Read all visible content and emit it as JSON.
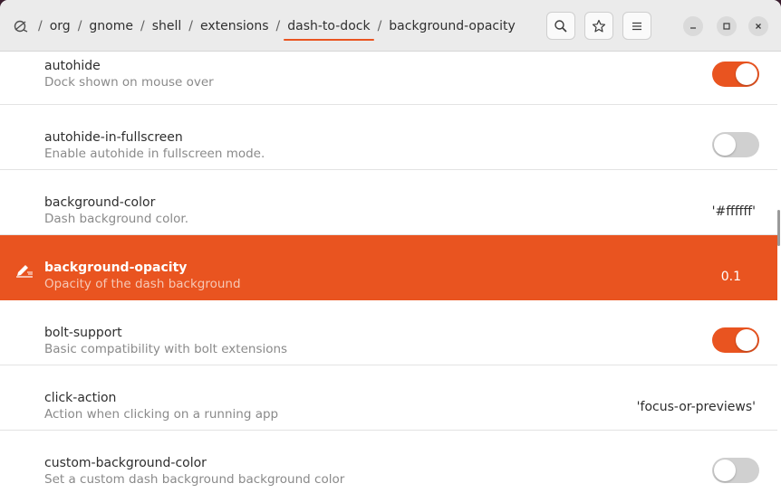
{
  "breadcrumb": {
    "root_icon": "dconf-editor-icon",
    "items": [
      "org",
      "gnome",
      "shell",
      "extensions",
      "dash-to-dock",
      "background-opacity"
    ],
    "separator": "/"
  },
  "header": {
    "search_icon": "search-icon",
    "bookmark_icon": "star-icon",
    "menu_icon": "hamburger-icon",
    "minimize_glyph": "–",
    "maximize_glyph": "□",
    "close_glyph": "×"
  },
  "accent_color": "#e95420",
  "rows": [
    {
      "name": "autohide",
      "description": "Dock shown on mouse over",
      "kind": "toggle",
      "state": true
    },
    {
      "name": "autohide-in-fullscreen",
      "description": "Enable autohide in fullscreen mode.",
      "kind": "toggle",
      "state": false
    },
    {
      "name": "background-color",
      "description": "Dash background color.",
      "kind": "value",
      "value": "'#ffffff'"
    },
    {
      "name": "background-opacity",
      "description": "Opacity of the dash background",
      "kind": "value",
      "value": "0.1",
      "selected": true
    },
    {
      "name": "bolt-support",
      "description": "Basic compatibility with bolt extensions",
      "kind": "toggle",
      "state": true
    },
    {
      "name": "click-action",
      "description": "Action when clicking on a running app",
      "kind": "value",
      "value": "'focus-or-previews'"
    },
    {
      "name": "custom-background-color",
      "description": "Set a custom dash background background color",
      "kind": "toggle",
      "state": false
    }
  ]
}
